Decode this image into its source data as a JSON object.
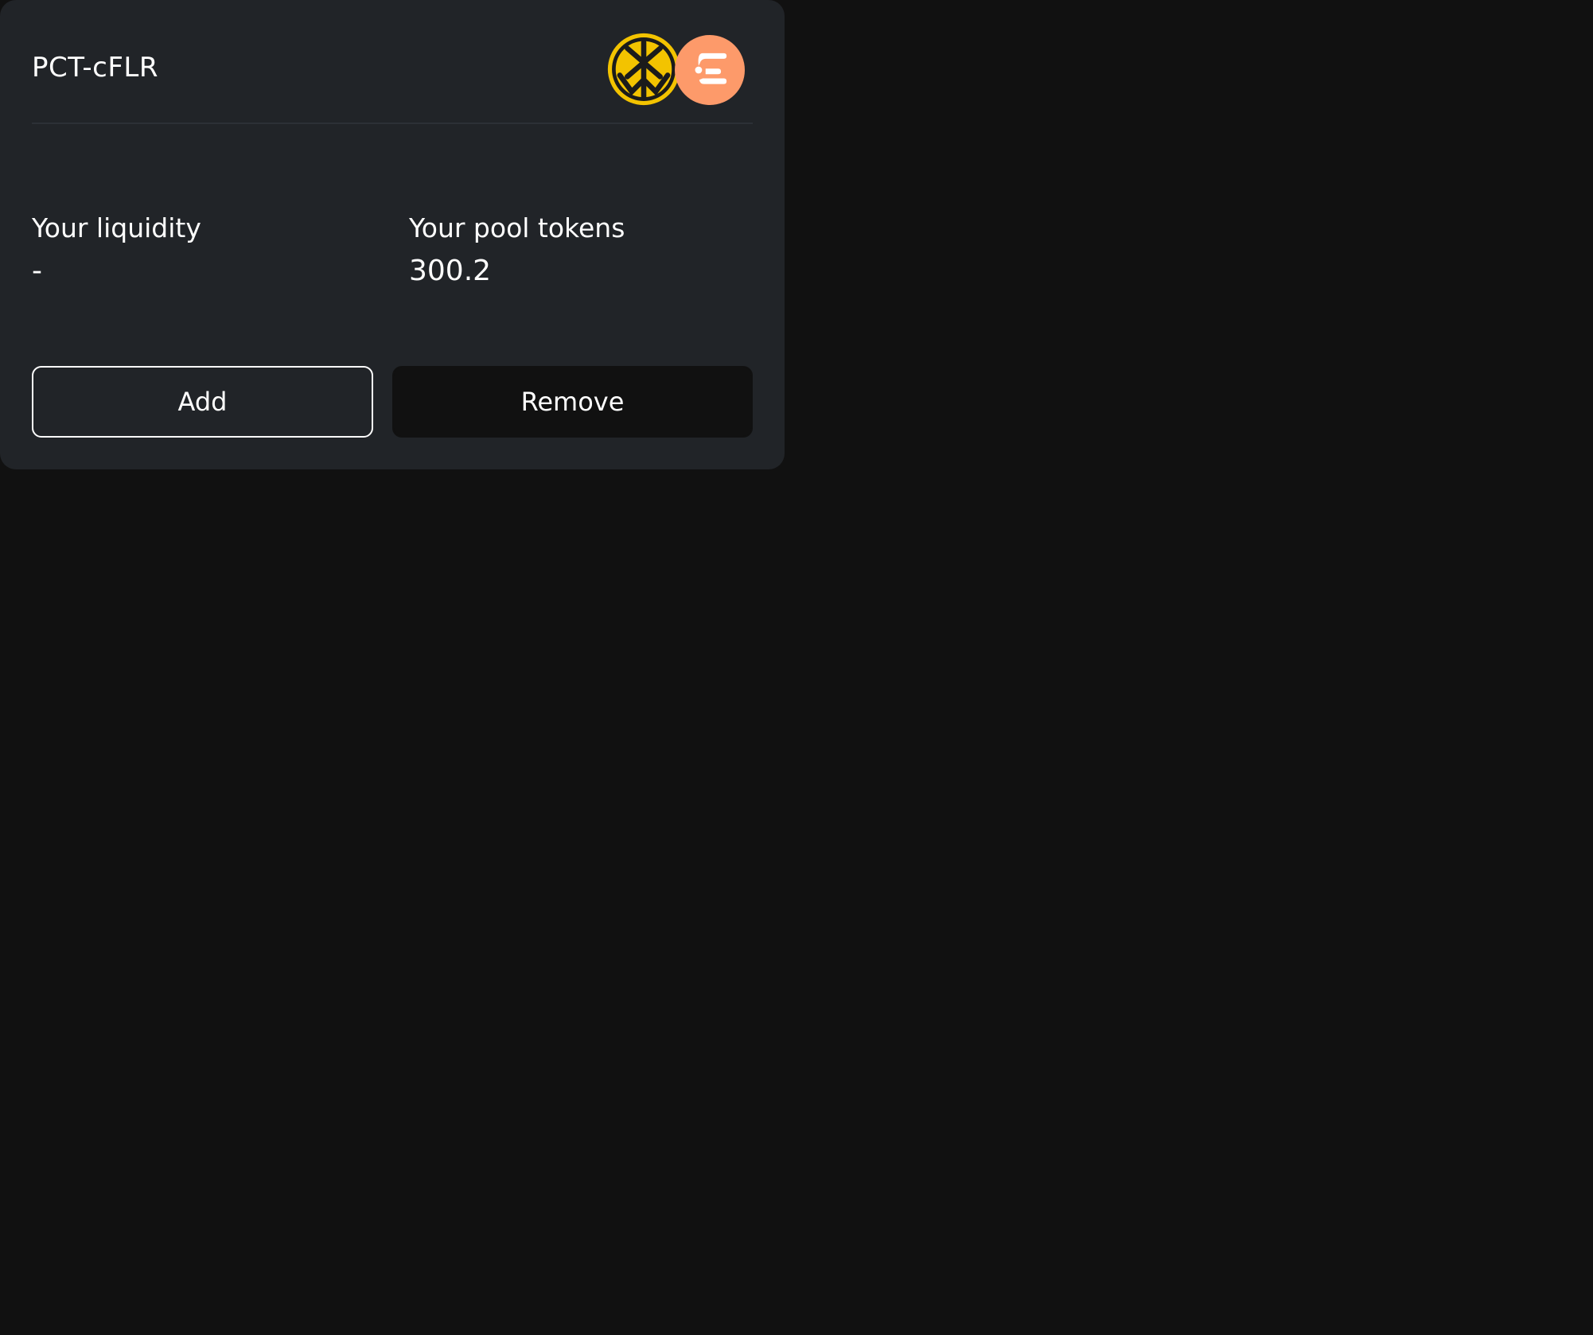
{
  "pool": {
    "pair_name": "PCT-cFLR",
    "tokens": [
      {
        "symbol_icon": "pct-token-icon",
        "color": "#f3c300"
      },
      {
        "symbol_icon": "cflr-token-icon",
        "color": "#fd9a6a"
      }
    ]
  },
  "stats": {
    "liquidity_label": "Your liquidity",
    "liquidity_value": "-",
    "pool_tokens_label": "Your pool tokens",
    "pool_tokens_value": "300.2"
  },
  "actions": {
    "add_label": "Add",
    "remove_label": "Remove"
  },
  "colors": {
    "page_background": "#111111",
    "card_background": "#212428",
    "text": "#ffffff"
  }
}
